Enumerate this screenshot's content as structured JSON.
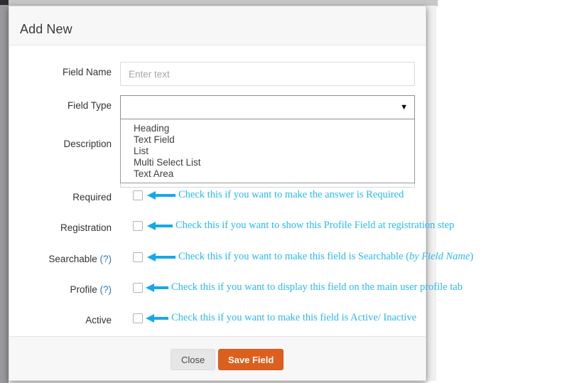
{
  "modal": {
    "title": "Add New",
    "fields": {
      "field_name": {
        "label": "Field Name",
        "placeholder": "Enter text",
        "value": ""
      },
      "field_type": {
        "label": "Field Type",
        "value": "",
        "arrow_glyph": "▼",
        "options": [
          "Heading",
          "Text Field",
          "List",
          "Multi Select List",
          "Text Area"
        ]
      },
      "description": {
        "label": "Description",
        "value": ""
      },
      "required": {
        "label": "Required"
      },
      "registration": {
        "label": "Registration"
      },
      "searchable": {
        "label": "Searchable",
        "help": "(?)"
      },
      "profile": {
        "label": "Profile",
        "help": "(?)"
      },
      "active": {
        "label": "Active"
      }
    },
    "annotations": {
      "required": "Check this if you want to make the answer is Required",
      "registration": "Check this if you want to show this Profile Field at registration step",
      "searchable_main": "Check this if you want to make this field is Searchable (",
      "searchable_italic": "by Field Name",
      "searchable_tail": ")",
      "profile": "Check this if you want to display this field on the main user profile tab",
      "active": "Check this if you want to make this field is Active/ Inactive"
    },
    "footer": {
      "close_label": "Close",
      "save_label": "Save Field"
    }
  },
  "colors": {
    "accent_orange": "#dd5f1e",
    "annotation_cyan": "#2bb8ee",
    "help_link_blue": "#337ab7"
  }
}
